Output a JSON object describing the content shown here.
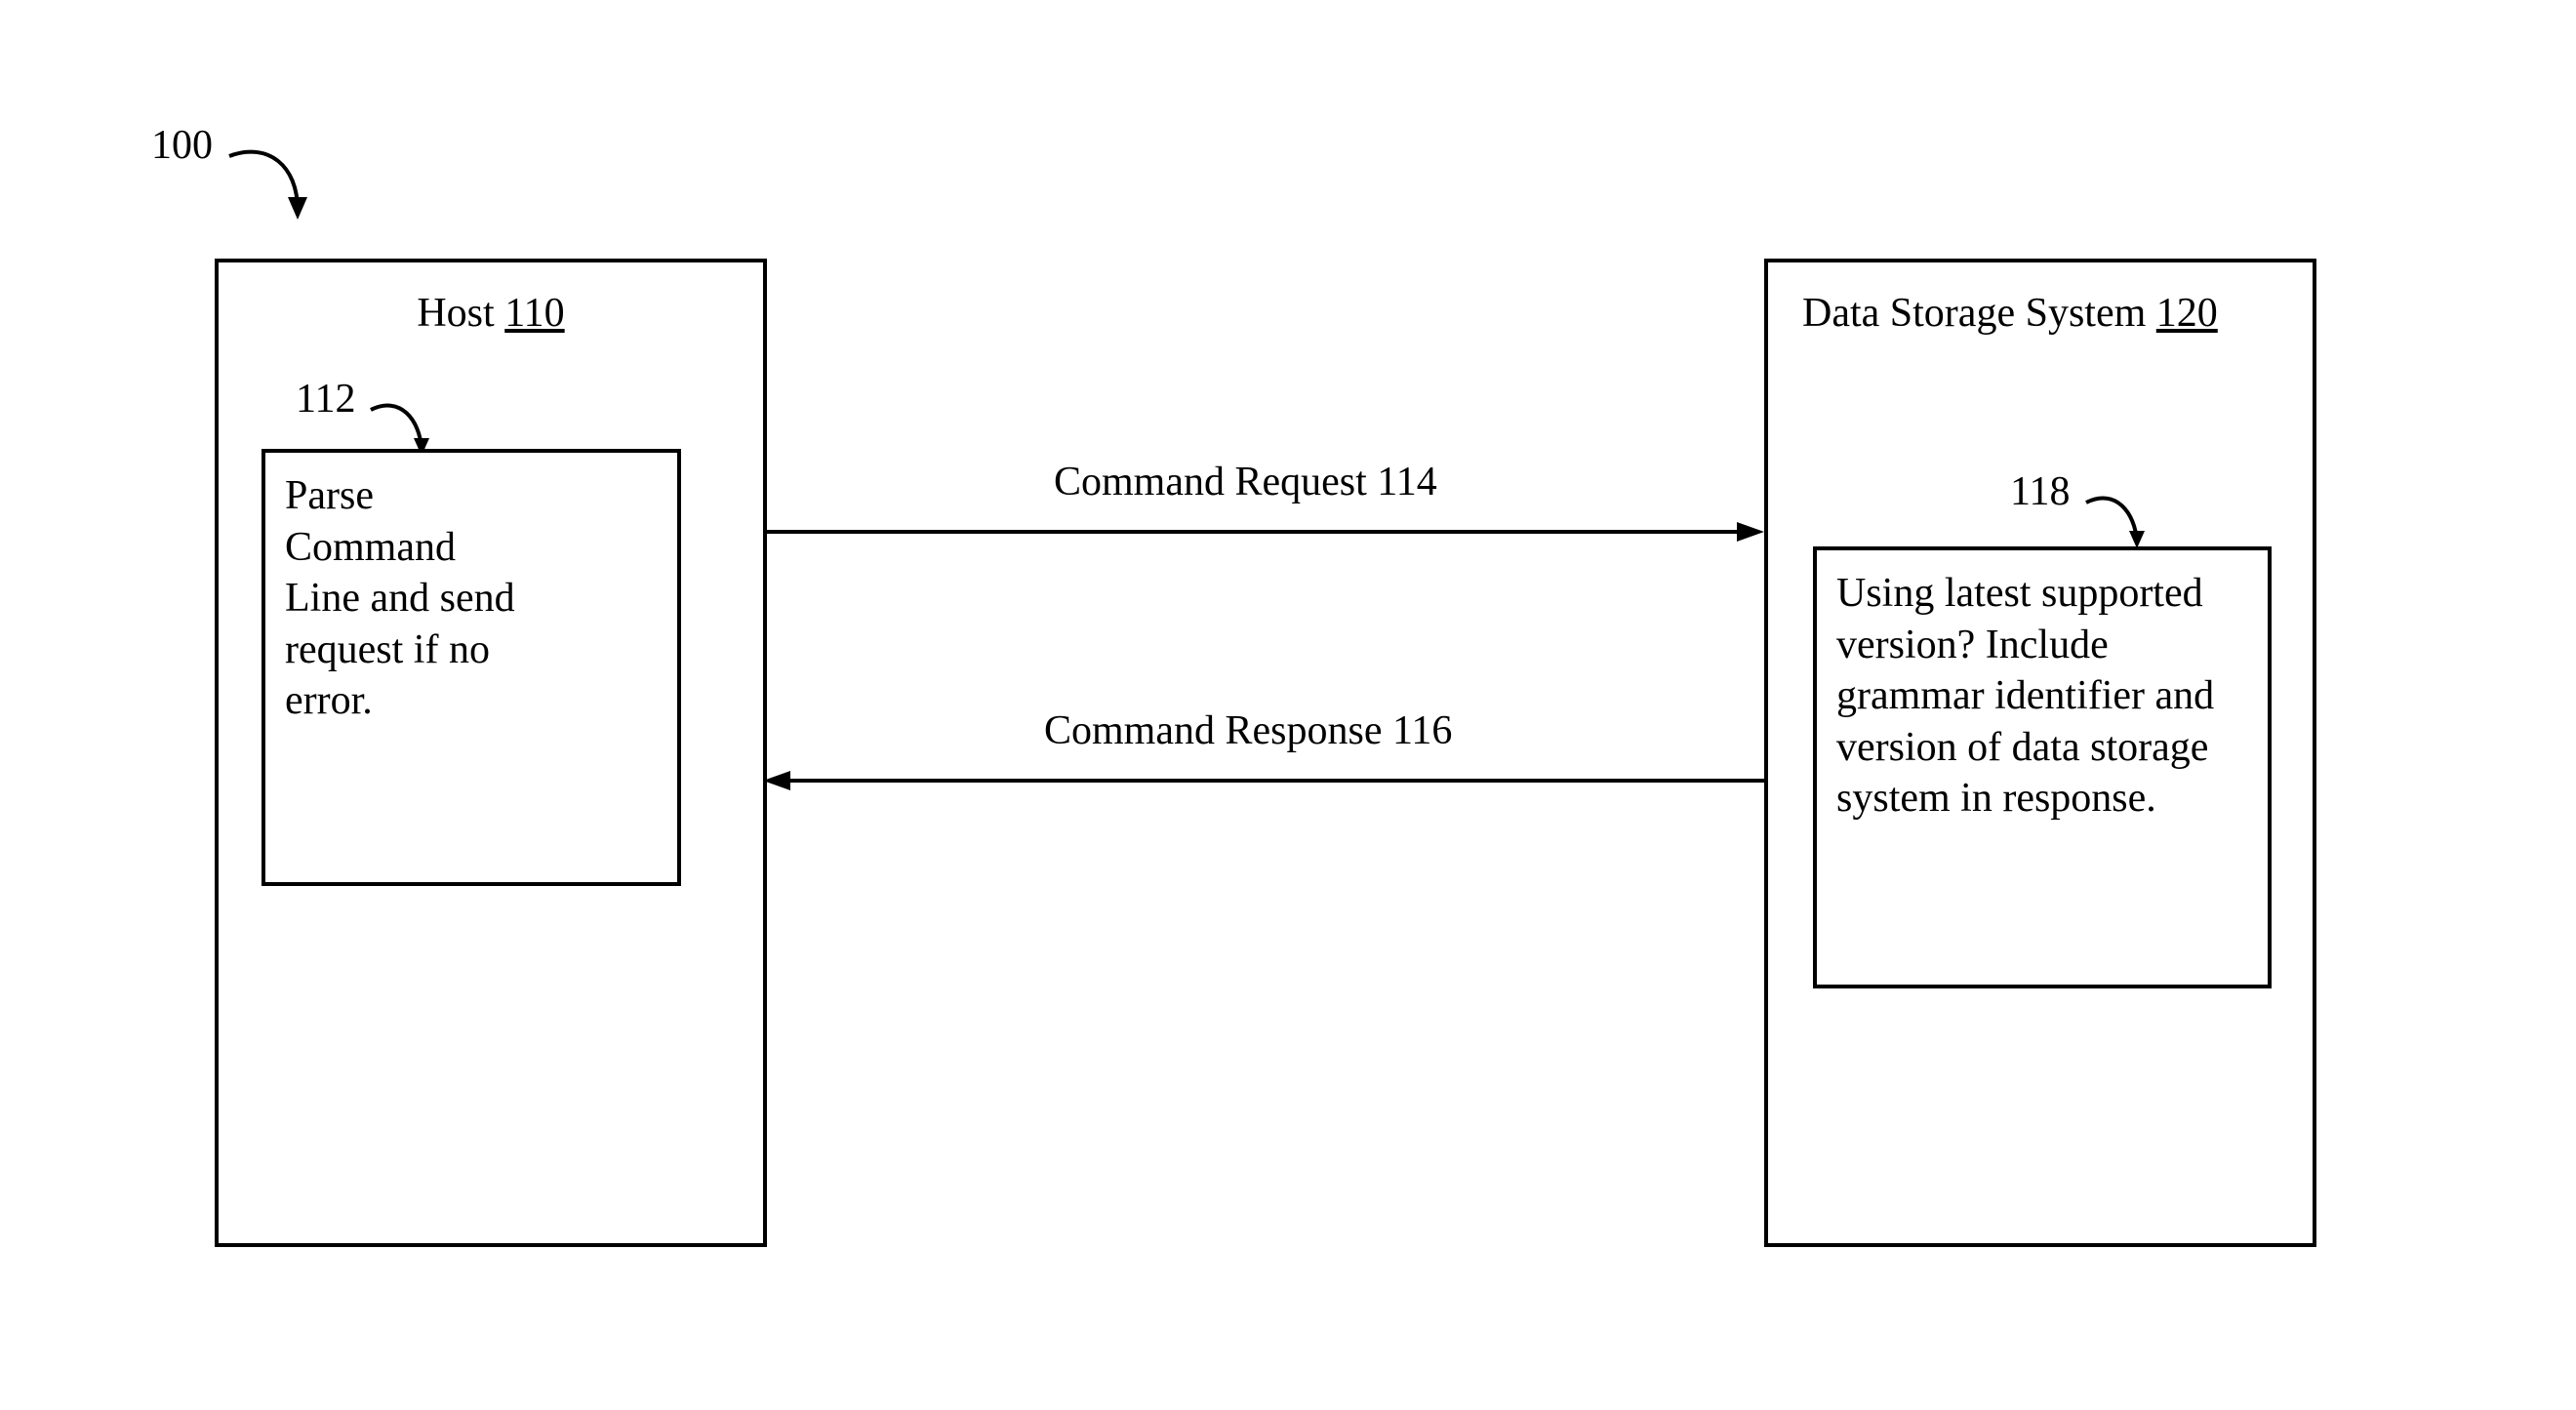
{
  "fig_ref": "100",
  "host": {
    "title_prefix": "Host ",
    "ref": "110",
    "inner_ref": "112",
    "inner_text": "Parse Command Line and send request if no error."
  },
  "storage": {
    "title_prefix": "Data Storage System ",
    "ref": "120",
    "inner_ref": "118",
    "inner_text": "Using latest supported version? Include grammar identifier and version of data storage system in response."
  },
  "arrows": {
    "request": "Command Request 114",
    "response": "Command Response 116"
  }
}
